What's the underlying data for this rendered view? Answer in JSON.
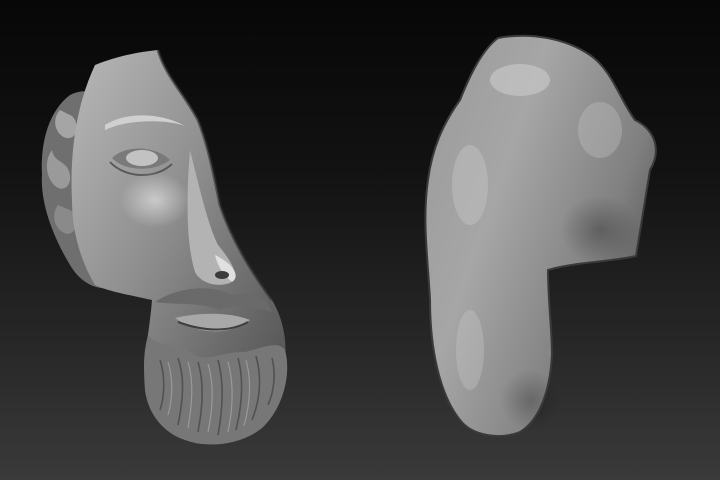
{
  "scene": {
    "subjects": [
      {
        "id": "front",
        "name": "sculpted-face-fragment-front"
      },
      {
        "id": "back",
        "name": "sculpted-face-fragment-back"
      }
    ],
    "colors": {
      "background_top": "#070707",
      "background_bottom": "#3a3a3a",
      "clay_light": "#c4c4c4",
      "clay_mid": "#8c8c8c",
      "clay_dark": "#3c3c3c"
    }
  }
}
